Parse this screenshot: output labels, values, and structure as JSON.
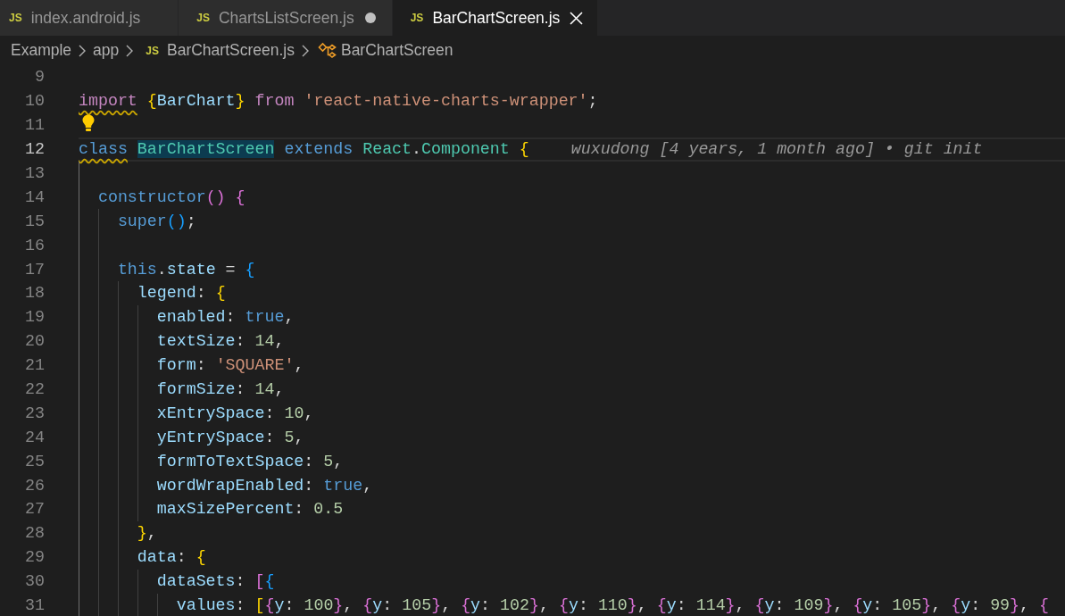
{
  "tabs": [
    {
      "icon": "JS",
      "label": "index.android.js",
      "selected": false,
      "modified": false
    },
    {
      "icon": "JS",
      "label": "ChartsListScreen.js",
      "selected": false,
      "modified": true
    },
    {
      "icon": "JS",
      "label": "BarChartScreen.js",
      "selected": true,
      "modified": false
    }
  ],
  "breadcrumbs": [
    {
      "kind": "folder",
      "label": "Example"
    },
    {
      "kind": "folder",
      "label": "app"
    },
    {
      "kind": "file",
      "icon": "JS",
      "label": "BarChartScreen.js"
    },
    {
      "kind": "symbol",
      "label": "BarChartScreen"
    }
  ],
  "editor": {
    "lines": [
      {
        "number": "9",
        "active": false
      },
      {
        "number": "10",
        "active": false,
        "tokens": [
          {
            "text": "import",
            "kind": "keyword",
            "warning": true
          },
          {
            "text": " {",
            "kind": "bracket1"
          },
          {
            "text": "BarChart",
            "kind": "variable"
          },
          {
            "text": "}",
            "kind": "bracket1"
          },
          {
            "text": " from",
            "kind": "keyword"
          },
          {
            "text": " 'react-native-charts-wrapper'",
            "kind": "string"
          },
          {
            "text": ";",
            "kind": "plain"
          }
        ]
      },
      {
        "number": "11",
        "active": false,
        "lightbulb": true
      },
      {
        "number": "12",
        "active": true,
        "tokens": [
          {
            "text": "class",
            "kind": "storage",
            "warning": true
          },
          {
            "text": " BarChartScreen",
            "kind": "type",
            "highlight": true
          },
          {
            "text": " extends",
            "kind": "storage"
          },
          {
            "text": " React",
            "kind": "type"
          },
          {
            "text": ".",
            "kind": "plain"
          },
          {
            "text": "Component",
            "kind": "type"
          },
          {
            "text": " {",
            "kind": "bracket1"
          }
        ],
        "blame": "wuxudong [4 years, 1 month ago] • git init"
      },
      {
        "number": "13",
        "active": false
      },
      {
        "number": "14",
        "active": false,
        "tokens": [
          {
            "text": "  constructor",
            "kind": "storage"
          },
          {
            "text": "()",
            "kind": "bracket2"
          },
          {
            "text": " {",
            "kind": "bracket2"
          }
        ]
      },
      {
        "number": "15",
        "active": false,
        "tokens": [
          {
            "text": "    super",
            "kind": "storage"
          },
          {
            "text": "()",
            "kind": "bracket3"
          },
          {
            "text": ";",
            "kind": "plain"
          }
        ]
      },
      {
        "number": "16",
        "active": false
      },
      {
        "number": "17",
        "active": false,
        "tokens": [
          {
            "text": "    this",
            "kind": "storage"
          },
          {
            "text": ".",
            "kind": "plain"
          },
          {
            "text": "state",
            "kind": "variable"
          },
          {
            "text": " =",
            "kind": "plain"
          },
          {
            "text": " {",
            "kind": "bracket3"
          }
        ]
      },
      {
        "number": "18",
        "active": false,
        "tokens": [
          {
            "text": "      legend",
            "kind": "variable"
          },
          {
            "text": ":",
            "kind": "plain"
          },
          {
            "text": " {",
            "kind": "bracket1"
          }
        ]
      },
      {
        "number": "19",
        "active": false,
        "tokens": [
          {
            "text": "        enabled",
            "kind": "variable"
          },
          {
            "text": ":",
            "kind": "plain"
          },
          {
            "text": " true",
            "kind": "storage"
          },
          {
            "text": ",",
            "kind": "plain"
          }
        ]
      },
      {
        "number": "20",
        "active": false,
        "tokens": [
          {
            "text": "        textSize",
            "kind": "variable"
          },
          {
            "text": ":",
            "kind": "plain"
          },
          {
            "text": " 14",
            "kind": "number"
          },
          {
            "text": ",",
            "kind": "plain"
          }
        ]
      },
      {
        "number": "21",
        "active": false,
        "tokens": [
          {
            "text": "        form",
            "kind": "variable"
          },
          {
            "text": ":",
            "kind": "plain"
          },
          {
            "text": " 'SQUARE'",
            "kind": "string"
          },
          {
            "text": ",",
            "kind": "plain"
          }
        ]
      },
      {
        "number": "22",
        "active": false,
        "tokens": [
          {
            "text": "        formSize",
            "kind": "variable"
          },
          {
            "text": ":",
            "kind": "plain"
          },
          {
            "text": " 14",
            "kind": "number"
          },
          {
            "text": ",",
            "kind": "plain"
          }
        ]
      },
      {
        "number": "23",
        "active": false,
        "tokens": [
          {
            "text": "        xEntrySpace",
            "kind": "variable"
          },
          {
            "text": ":",
            "kind": "plain"
          },
          {
            "text": " 10",
            "kind": "number"
          },
          {
            "text": ",",
            "kind": "plain"
          }
        ]
      },
      {
        "number": "24",
        "active": false,
        "tokens": [
          {
            "text": "        yEntrySpace",
            "kind": "variable"
          },
          {
            "text": ":",
            "kind": "plain"
          },
          {
            "text": " 5",
            "kind": "number"
          },
          {
            "text": ",",
            "kind": "plain"
          }
        ]
      },
      {
        "number": "25",
        "active": false,
        "tokens": [
          {
            "text": "        formToTextSpace",
            "kind": "variable"
          },
          {
            "text": ":",
            "kind": "plain"
          },
          {
            "text": " 5",
            "kind": "number"
          },
          {
            "text": ",",
            "kind": "plain"
          }
        ]
      },
      {
        "number": "26",
        "active": false,
        "tokens": [
          {
            "text": "        wordWrapEnabled",
            "kind": "variable"
          },
          {
            "text": ":",
            "kind": "plain"
          },
          {
            "text": " true",
            "kind": "storage"
          },
          {
            "text": ",",
            "kind": "plain"
          }
        ]
      },
      {
        "number": "27",
        "active": false,
        "tokens": [
          {
            "text": "        maxSizePercent",
            "kind": "variable"
          },
          {
            "text": ":",
            "kind": "plain"
          },
          {
            "text": " 0.5",
            "kind": "number"
          }
        ]
      },
      {
        "number": "28",
        "active": false,
        "tokens": [
          {
            "text": "      }",
            "kind": "bracket1"
          },
          {
            "text": ",",
            "kind": "plain"
          }
        ]
      },
      {
        "number": "29",
        "active": false,
        "tokens": [
          {
            "text": "      data",
            "kind": "variable"
          },
          {
            "text": ":",
            "kind": "plain"
          },
          {
            "text": " {",
            "kind": "bracket1"
          }
        ]
      },
      {
        "number": "30",
        "active": false,
        "tokens": [
          {
            "text": "        dataSets",
            "kind": "variable"
          },
          {
            "text": ":",
            "kind": "plain"
          },
          {
            "text": " [",
            "kind": "bracket2"
          },
          {
            "text": "{",
            "kind": "bracket3"
          }
        ]
      },
      {
        "number": "31",
        "active": false,
        "tokens": [
          {
            "text": "          values",
            "kind": "variable"
          },
          {
            "text": ":",
            "kind": "plain"
          },
          {
            "text": " [",
            "kind": "bracket1"
          },
          {
            "text": "{",
            "kind": "bracket2"
          },
          {
            "text": "y",
            "kind": "variable"
          },
          {
            "text": ":",
            "kind": "plain"
          },
          {
            "text": " 100",
            "kind": "number"
          },
          {
            "text": "}",
            "kind": "bracket2"
          },
          {
            "text": ",",
            "kind": "plain"
          },
          {
            "text": " {",
            "kind": "bracket2"
          },
          {
            "text": "y",
            "kind": "variable"
          },
          {
            "text": ":",
            "kind": "plain"
          },
          {
            "text": " 105",
            "kind": "number"
          },
          {
            "text": "}",
            "kind": "bracket2"
          },
          {
            "text": ",",
            "kind": "plain"
          },
          {
            "text": " {",
            "kind": "bracket2"
          },
          {
            "text": "y",
            "kind": "variable"
          },
          {
            "text": ":",
            "kind": "plain"
          },
          {
            "text": " 102",
            "kind": "number"
          },
          {
            "text": "}",
            "kind": "bracket2"
          },
          {
            "text": ",",
            "kind": "plain"
          },
          {
            "text": " {",
            "kind": "bracket2"
          },
          {
            "text": "y",
            "kind": "variable"
          },
          {
            "text": ":",
            "kind": "plain"
          },
          {
            "text": " 110",
            "kind": "number"
          },
          {
            "text": "}",
            "kind": "bracket2"
          },
          {
            "text": ",",
            "kind": "plain"
          },
          {
            "text": " {",
            "kind": "bracket2"
          },
          {
            "text": "y",
            "kind": "variable"
          },
          {
            "text": ":",
            "kind": "plain"
          },
          {
            "text": " 114",
            "kind": "number"
          },
          {
            "text": "}",
            "kind": "bracket2"
          },
          {
            "text": ",",
            "kind": "plain"
          },
          {
            "text": " {",
            "kind": "bracket2"
          },
          {
            "text": "y",
            "kind": "variable"
          },
          {
            "text": ":",
            "kind": "plain"
          },
          {
            "text": " 109",
            "kind": "number"
          },
          {
            "text": "}",
            "kind": "bracket2"
          },
          {
            "text": ",",
            "kind": "plain"
          },
          {
            "text": " {",
            "kind": "bracket2"
          },
          {
            "text": "y",
            "kind": "variable"
          },
          {
            "text": ":",
            "kind": "plain"
          },
          {
            "text": " 105",
            "kind": "number"
          },
          {
            "text": "}",
            "kind": "bracket2"
          },
          {
            "text": ",",
            "kind": "plain"
          },
          {
            "text": " {",
            "kind": "bracket2"
          },
          {
            "text": "y",
            "kind": "variable"
          },
          {
            "text": ":",
            "kind": "plain"
          },
          {
            "text": " 99",
            "kind": "number"
          },
          {
            "text": "}",
            "kind": "bracket2"
          },
          {
            "text": ",",
            "kind": "plain"
          },
          {
            "text": " {",
            "kind": "bracket2"
          }
        ]
      }
    ]
  }
}
